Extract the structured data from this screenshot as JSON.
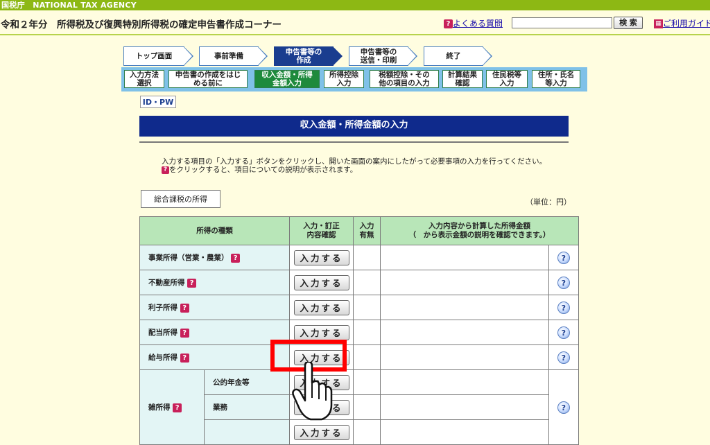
{
  "agency": "国税庁　NATIONAL TAX AGENCY",
  "title": "令和２年分　所得税及び復興特別所得税の確定申告書作成コーナー",
  "header": {
    "faq_label": "よくある質問",
    "search_button": "検 索",
    "guide_label": "ご利用ガイド"
  },
  "steps_main": [
    {
      "label": "トップ画面"
    },
    {
      "label": "事前準備"
    },
    {
      "label": "申告書等の\n作成"
    },
    {
      "label": "申告書等の\n送信・印刷"
    },
    {
      "label": "終了"
    }
  ],
  "steps_sub": [
    {
      "label": "入力方法\n選択"
    },
    {
      "label": "申告書の作成をはじ\nめる前に"
    },
    {
      "label": "収入金額・所得\n金額入力"
    },
    {
      "label": "所得控除\n入力"
    },
    {
      "label": "税額控除・その\n他の項目の入力"
    },
    {
      "label": "計算結果\n確認"
    },
    {
      "label": "住民税等\n入力"
    },
    {
      "label": "住所・氏名\n等入力"
    }
  ],
  "idpw_label": "ID・PW",
  "page_heading": "収入金額・所得金額の入力",
  "instructions": {
    "line1": "入力する項目の「入力する」ボタンをクリックし、開いた画面の案内にしたがって必要事項の入力を行ってください。",
    "line2": "をクリックすると、項目についての説明が表示されます。"
  },
  "section_label": "総合課税の所得",
  "unit_label": "（単位：円）",
  "table": {
    "headers": {
      "type": "所得の種類",
      "action": "入力・訂正\n内容確認",
      "status": "入力\n有無",
      "amount_line1": "入力内容から計算した所得金額",
      "amount_line2": "（　から表示金額の説明を確認できます。）"
    },
    "button_label": "入力する",
    "rows": [
      {
        "label": "事業所得（営業・農業）"
      },
      {
        "label": "不動産所得"
      },
      {
        "label": "利子所得"
      },
      {
        "label": "配当所得"
      },
      {
        "label": "給与所得"
      }
    ],
    "misc": {
      "label": "雑所得",
      "sub": [
        "公的年金等",
        "業務",
        ""
      ]
    }
  }
}
